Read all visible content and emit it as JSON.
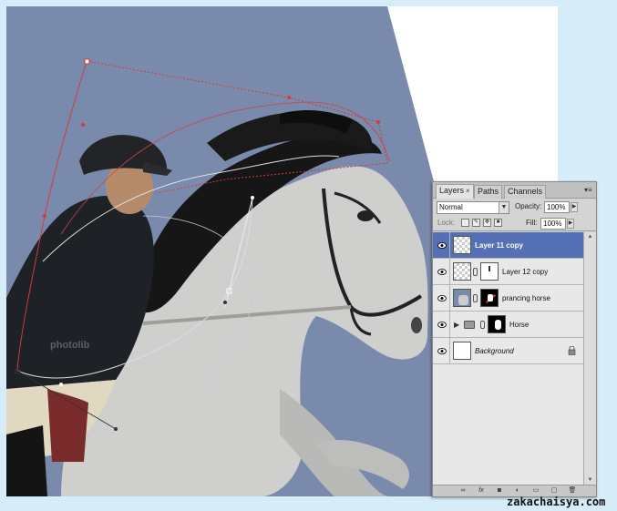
{
  "canvas": {
    "background_color": "#7a8aac",
    "photo_overlay_text": "photolib",
    "path_color": "#d43a3a"
  },
  "layers_panel": {
    "tabs": [
      {
        "label": "Layers",
        "active": true,
        "close": "×"
      },
      {
        "label": "Paths",
        "active": false
      },
      {
        "label": "Channels",
        "active": false
      }
    ],
    "menu_glyph": "▾≡",
    "blend_mode": "Normal",
    "opacity_label": "Opacity:",
    "opacity_value": "100%",
    "lock_label": "Lock:",
    "fill_label": "Fill:",
    "fill_value": "100%",
    "layers": [
      {
        "name": "Layer 11 copy",
        "selected": true
      },
      {
        "name": "Layer 12 copy",
        "selected": false
      },
      {
        "name": "prancing horse",
        "selected": false
      },
      {
        "name": "Horse",
        "selected": false,
        "group": true
      },
      {
        "name": "Background",
        "selected": false,
        "locked": true
      }
    ],
    "bottom_tools": [
      "link-icon",
      "fx-icon",
      "mask-icon",
      "adjustment-icon",
      "folder-icon",
      "new-layer-icon",
      "trash-icon"
    ],
    "bottom_glyphs": [
      "∞",
      "fx",
      "◙",
      "◐",
      "▭",
      "▢",
      "🗑"
    ]
  },
  "watermark": "zakachaisya.com"
}
